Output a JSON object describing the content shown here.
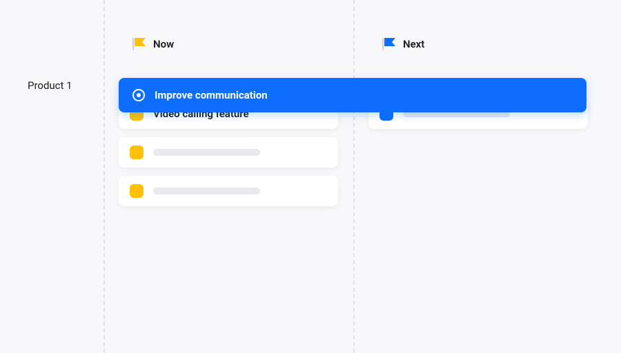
{
  "row": {
    "label": "Product 1"
  },
  "columns": {
    "now": {
      "title": "Now",
      "flag_color": "#ffc107"
    },
    "next": {
      "title": "Next",
      "flag_color": "#0d6efd"
    }
  },
  "goal": {
    "title": "Improve communication"
  },
  "cards": {
    "now": [
      {
        "title": "Video calling feature",
        "chip": "yellow",
        "placeholder": false
      },
      {
        "title": "",
        "chip": "yellow",
        "placeholder": true
      },
      {
        "title": "",
        "chip": "yellow",
        "placeholder": true
      }
    ],
    "next": [
      {
        "title": "",
        "chip": "blue",
        "placeholder": true
      }
    ]
  },
  "colors": {
    "accent_blue": "#0d6efd",
    "accent_yellow": "#ffc107"
  }
}
